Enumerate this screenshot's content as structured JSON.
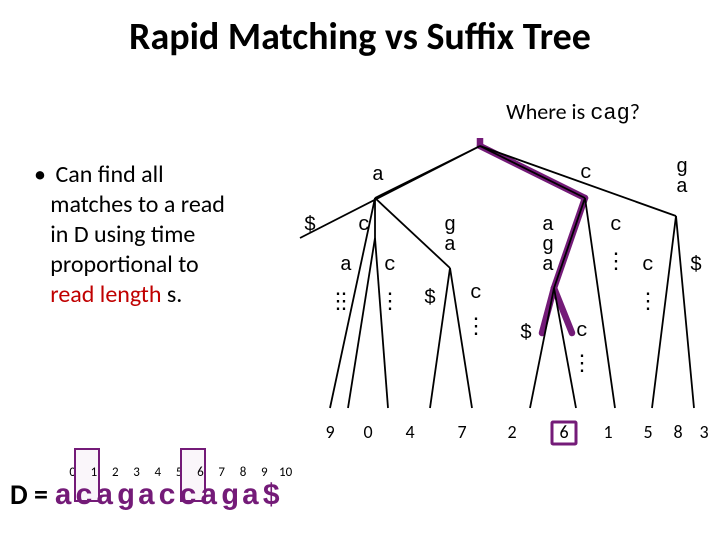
{
  "title": "Rapid Matching vs Suffix Tree",
  "subtitle": {
    "prefix": "Where is ",
    "query": "cag",
    "suffix": "?"
  },
  "bullet": {
    "line1": "Can find all",
    "line2": "matches to a read",
    "line3": "in D using time",
    "line4": "proportional to ",
    "highlight": "read length",
    "after": " s."
  },
  "indices": [
    "0",
    "1",
    "2",
    "3",
    "4",
    "5",
    "6",
    "7",
    "8",
    "9",
    "10"
  ],
  "D_prefix": "D = ",
  "D_string": "acagaccaga$",
  "tree": {
    "edge_a": "a",
    "edge_c": "c",
    "edge_ga": "g\na",
    "edge_dollar": "$",
    "edge_aga": "a\ng\na",
    "edge_c_short": "c",
    "edge_g": "g",
    "ellipsis": "⋮"
  },
  "leaves": [
    "9",
    "0",
    "4",
    "7",
    "2",
    "6",
    "1",
    "5",
    "8",
    "3"
  ]
}
